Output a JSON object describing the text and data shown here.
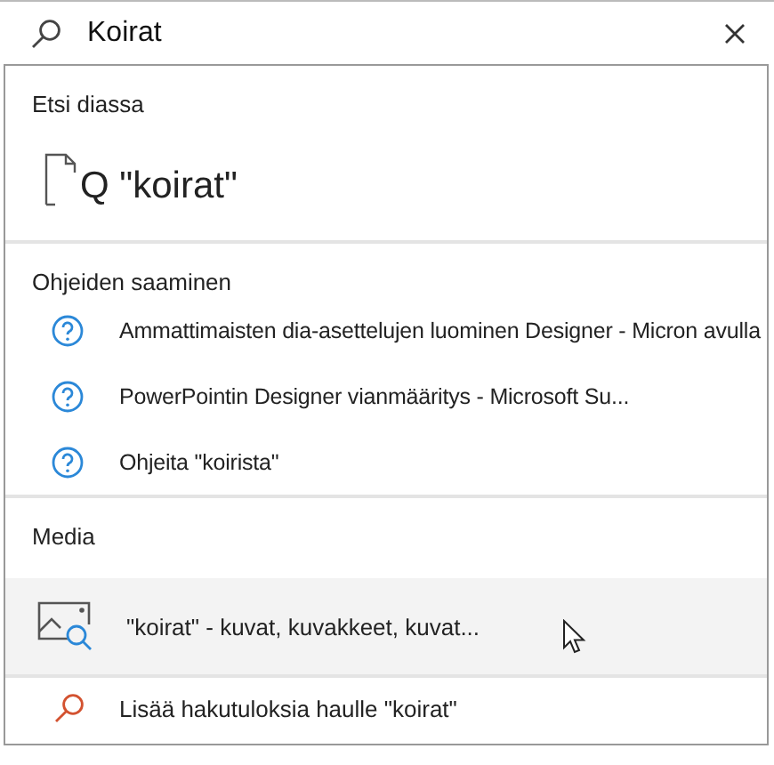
{
  "search": {
    "value": "Koirat"
  },
  "sections": [
    {
      "heading": "Etsi diassa",
      "items": [
        {
          "kind": "slide",
          "text": "Q \"koirat\"",
          "selected": false
        }
      ]
    },
    {
      "heading": "Ohjeiden saaminen",
      "items": [
        {
          "kind": "help",
          "text": "Ammattimaisten dia-asettelujen luominen Designer - Micron avulla",
          "selected": false
        },
        {
          "kind": "help",
          "text": "PowerPointin Designer vianmääritys - Microsoft Su...",
          "selected": false
        },
        {
          "kind": "help",
          "text": "Ohjeita \"koirista\"",
          "selected": false
        }
      ]
    },
    {
      "heading": "Media",
      "items": [
        {
          "kind": "media",
          "text": "\"koirat\" - kuvat, kuvakkeet, kuvat...",
          "selected": true
        }
      ]
    }
  ],
  "more_results": "Lisää hakutuloksia haulle \"koirat\""
}
